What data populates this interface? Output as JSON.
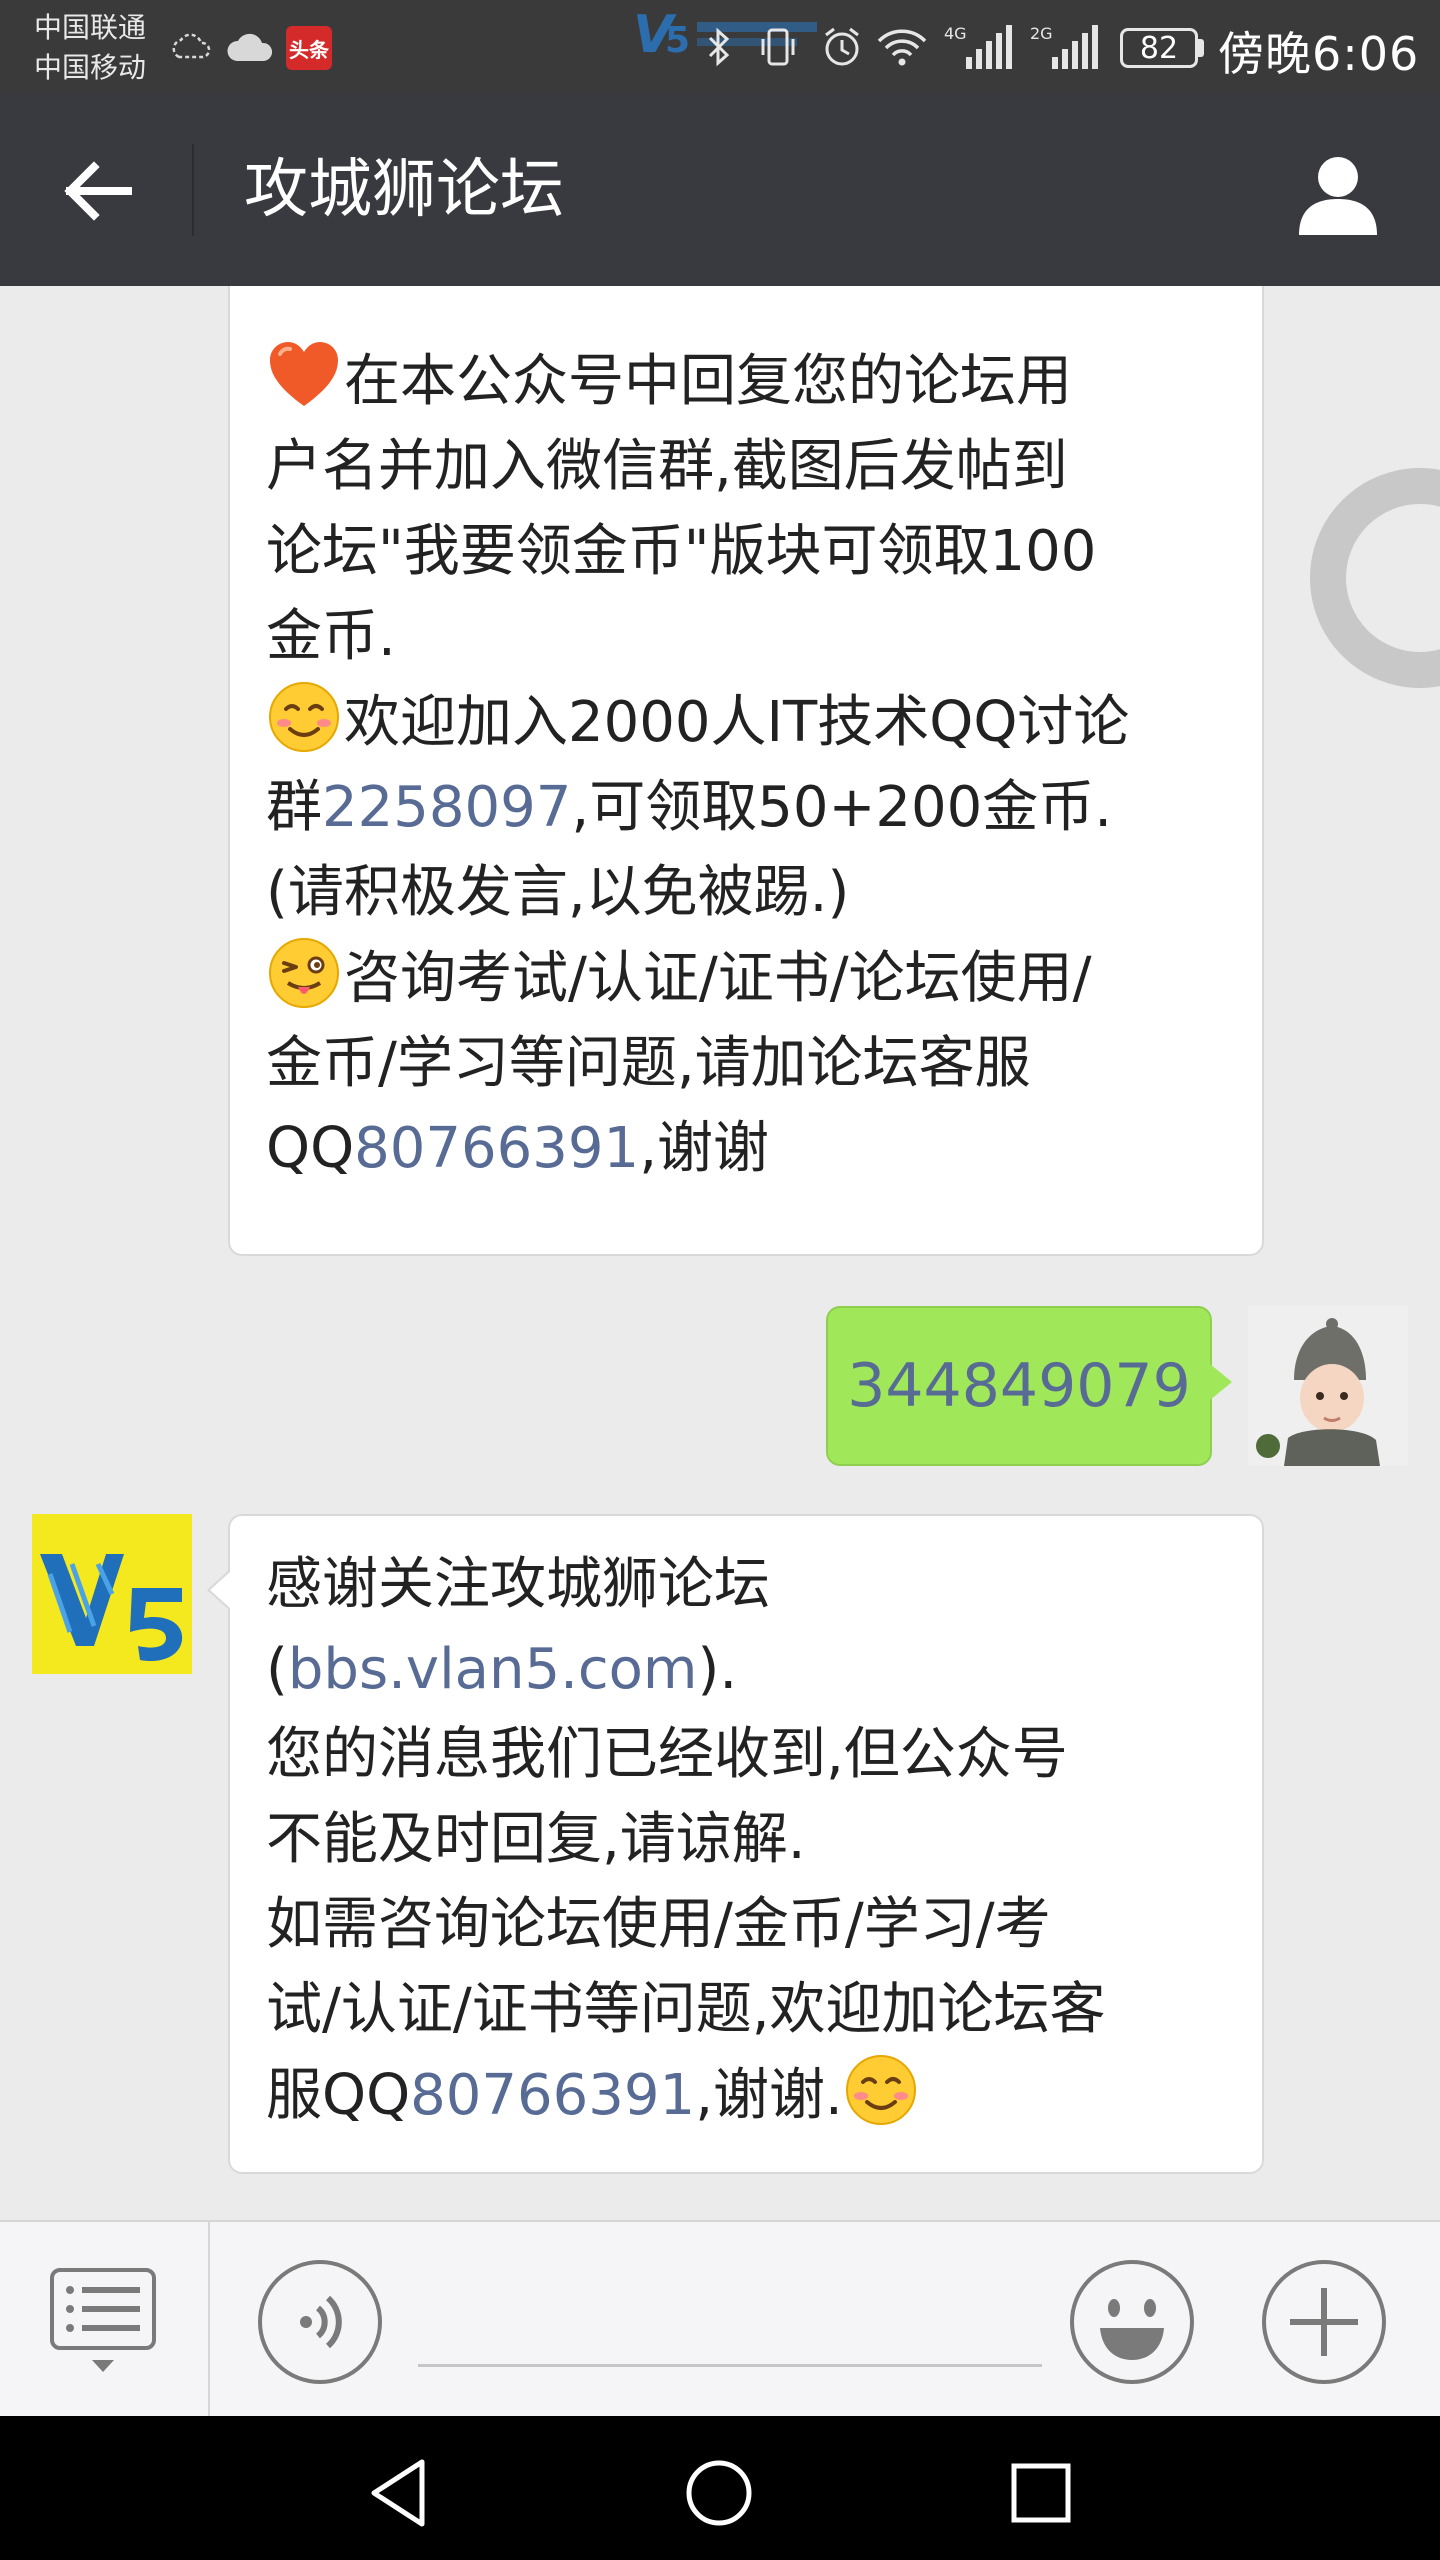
{
  "status_bar": {
    "carrier_1": "中国联通",
    "carrier_2": "中国移动",
    "toutiao_badge": "头条",
    "network_1": "4G",
    "network_2": "2G",
    "battery": "82",
    "time": "傍晚6:06",
    "icons": [
      "weather-icon",
      "cloud-icon",
      "toutiao-icon",
      "v5-icon",
      "bluetooth-icon",
      "vibrate-icon",
      "alarm-icon",
      "wifi-icon",
      "signal-icon",
      "signal-icon",
      "battery-icon"
    ]
  },
  "header": {
    "title": "攻城狮论坛",
    "back_icon": "arrow-left-icon",
    "profile_icon": "person-icon"
  },
  "messages": {
    "first": {
      "line1": "在本公众号中回复您的论坛用",
      "line2": "户名并加入微信群,截图后发帖到",
      "line3": "论坛\"我要领金币\"版块可领取100",
      "line4": "金币.",
      "line5": "欢迎加入2000人IT技术QQ讨论",
      "line6_pre": "群",
      "line6_link": "2258097",
      "line6_post": ",可领取50+200金币.",
      "line7": "(请积极发言,以免被踢.)",
      "line8": "咨询考试/认证/证书/论坛使用/",
      "line9": "金币/学习等问题,请加论坛客服",
      "line10_pre": "QQ",
      "line10_link": "80766391",
      "line10_post": ",谢谢"
    },
    "sent": {
      "text": "344849079"
    },
    "reply": {
      "line1": "感谢关注攻城狮论坛",
      "line2_pre": "(",
      "line2_link": "bbs.vlan5.com",
      "line2_post": ").",
      "line3": "您的消息我们已经收到,但公众号",
      "line4": "不能及时回复,请谅解.",
      "line5": "如需咨询论坛使用/金币/学习/考",
      "line6": "试/认证/证书等问题,欢迎加论坛客",
      "line7_pre": "服QQ",
      "line7_link": "80766391",
      "line7_post": ",谢谢."
    }
  },
  "input_bar": {
    "placeholder": "",
    "icons": [
      "menu-list-icon",
      "voice-icon",
      "emoji-face-icon",
      "plus-icon"
    ]
  },
  "nav_bar": {
    "icons": [
      "nav-back-icon",
      "nav-home-icon",
      "nav-recent-icon"
    ]
  },
  "colors": {
    "header_bg": "#393a3f",
    "sent_bubble": "#a0e75a",
    "link": "#576b95",
    "chat_bg": "#ebebeb"
  }
}
